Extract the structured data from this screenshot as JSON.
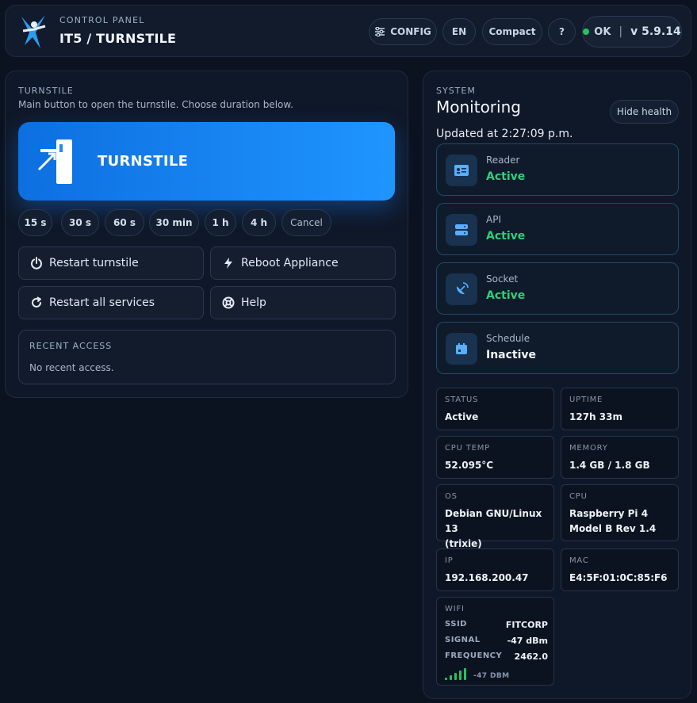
{
  "header": {
    "subtitle": "CONTROL PANEL",
    "title": "IT5 / TURNSTILE",
    "config_label": "CONFIG",
    "lang_label": "EN",
    "compact_label": "Compact",
    "help_label": "?",
    "status_label": "OK",
    "version": "v 5.9.14"
  },
  "turnstile": {
    "section_label": "TURNSTILE",
    "description": "Main button to open the turnstile. Choose duration below.",
    "main_button_label": "TURNSTILE",
    "durations": [
      "15 s",
      "30 s",
      "60 s",
      "30 min",
      "1 h",
      "4 h"
    ],
    "cancel_label": "Cancel",
    "actions": {
      "restart_turnstile": "Restart turnstile",
      "reboot_appliance": "Reboot Appliance",
      "restart_services": "Restart all services",
      "help": "Help"
    },
    "recent": {
      "label": "RECENT ACCESS",
      "empty_text": "No recent access."
    }
  },
  "system": {
    "section_label": "SYSTEM",
    "title": "Monitoring",
    "hide_health_label": "Hide health",
    "updated": "Updated at 2:27:09 p.m.",
    "services": [
      {
        "name": "Reader",
        "state": "Active",
        "icon": "id-card-icon"
      },
      {
        "name": "API",
        "state": "Active",
        "icon": "server-icon"
      },
      {
        "name": "Socket",
        "state": "Active",
        "icon": "satellite-dish-icon"
      },
      {
        "name": "Schedule",
        "state": "Inactive",
        "icon": "calendar-icon"
      }
    ],
    "stats": {
      "status": {
        "label": "STATUS",
        "value": "Active"
      },
      "uptime": {
        "label": "UPTIME",
        "value": "127h 33m"
      },
      "cpu_temp": {
        "label": "CPU TEMP",
        "value": "52.095°C"
      },
      "memory": {
        "label": "MEMORY",
        "value": "1.4 GB / 1.8 GB"
      },
      "os": {
        "label": "OS",
        "line1": "Debian GNU/Linux 13",
        "line2": "(trixie)"
      },
      "cpu": {
        "label": "CPU",
        "line1": "Raspberry Pi 4",
        "line2": "Model B Rev 1.4"
      },
      "ip": {
        "label": "IP",
        "value": "192.168.200.47"
      },
      "mac": {
        "label": "MAC",
        "value": "E4:5F:01:0C:85:F6"
      }
    },
    "wifi": {
      "label": "WIFI",
      "ssid_label": "SSID",
      "ssid": "FITCORP",
      "signal_label": "SIGNAL",
      "signal": "-47 dBm",
      "frequency_label": "FREQUENCY",
      "frequency": "2462.0",
      "bars_text": "-47 DBM",
      "bars_filled": 5
    }
  },
  "colors": {
    "accent": "#1f95ff",
    "active": "#2ecf7a",
    "inactive": "#f2f6fb"
  }
}
